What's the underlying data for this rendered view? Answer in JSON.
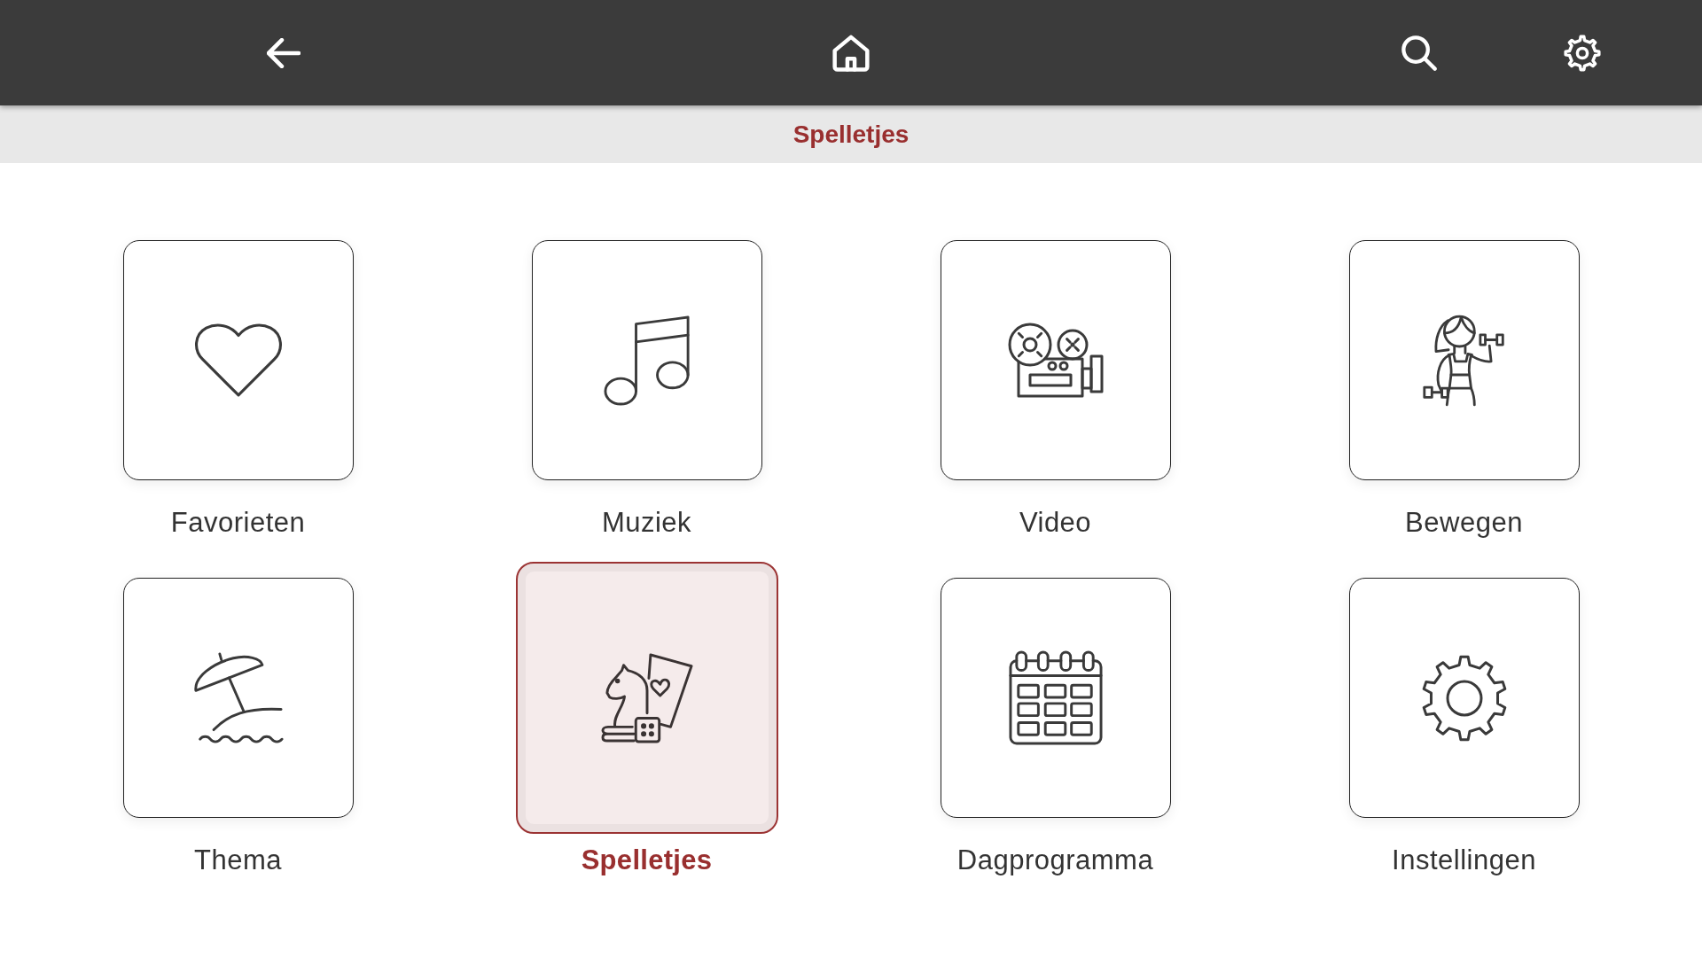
{
  "header": {
    "title": "Spelletjes"
  },
  "tiles": [
    {
      "label": "Favorieten",
      "selected": false
    },
    {
      "label": "Muziek",
      "selected": false
    },
    {
      "label": "Video",
      "selected": false
    },
    {
      "label": "Bewegen",
      "selected": false
    },
    {
      "label": "Thema",
      "selected": false
    },
    {
      "label": "Spelletjes",
      "selected": true
    },
    {
      "label": "Dagprogramma",
      "selected": false
    },
    {
      "label": "Instellingen",
      "selected": false
    }
  ]
}
